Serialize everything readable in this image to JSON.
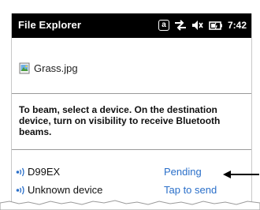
{
  "window": {
    "title": "File Explorer",
    "clock": "7:42",
    "status_icons": [
      "a-icon",
      "connectivity-arrows-icon",
      "speaker-icon",
      "battery-charging-icon"
    ],
    "status_letter": "a"
  },
  "file": {
    "name": "Grass.jpg",
    "icon": "image-file-icon"
  },
  "instructions": "To beam, select a device. On the destination device, turn on visibility to receive Bluetooth beams.",
  "devices": [
    {
      "name": "D99EX",
      "status": "Pending",
      "icon": "bluetooth-signal-icon"
    },
    {
      "name": "Unknown device",
      "status": "Tap to send",
      "icon": "bluetooth-signal-icon"
    }
  ],
  "colors": {
    "titlebar": "#000000",
    "link": "#2a6fc9",
    "text": "#111111"
  }
}
